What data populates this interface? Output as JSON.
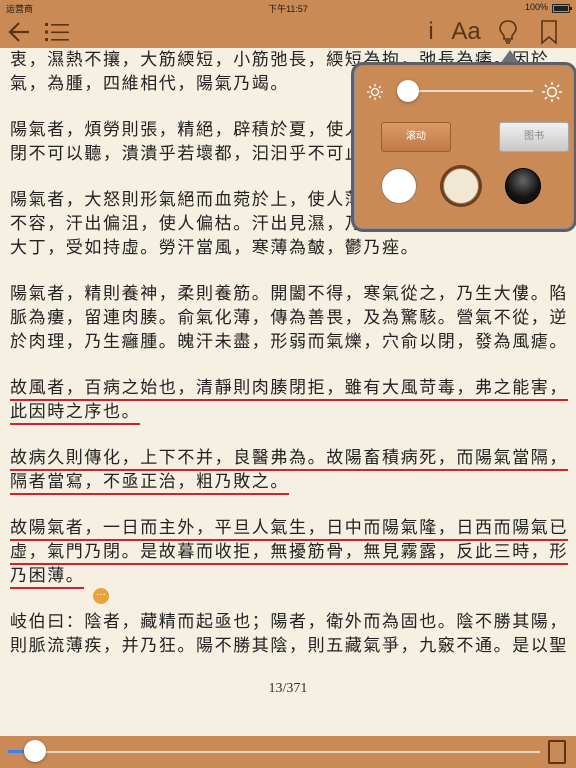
{
  "status_bar": {
    "carrier": "运营商",
    "time": "下午11:57",
    "battery": "100%"
  },
  "toolbar": {
    "back_icon": "arrow-left",
    "toc_icon": "list",
    "info_label": "i",
    "font_label": "Aa",
    "brightness_icon": "lightbulb",
    "bookmark_icon": "bookmark"
  },
  "content": {
    "paragraphs": [
      {
        "lines": [
          [
            {
              "t": "衷，濕熱不攘，大筋緛短，小筋弛長，緛短為拘，弛長為痿。因於"
            }
          ],
          [
            {
              "t": "氣，為腫，四維相代，陽氣乃竭。"
            }
          ]
        ]
      },
      {
        "lines": [
          [
            {
              "t": "陽氣者，煩勞則張，精絕，辟積於夏，使人煎厥。目盲不可以視，耳"
            }
          ],
          [
            {
              "t": "閉不可以聽，潰潰乎若壞都，汩汩乎不可止。"
            }
          ]
        ]
      },
      {
        "lines": [
          [
            {
              "t": "陽氣者，大怒則形氣絕而血菀於上，使人薄厥。有傷於筋，縱，其若"
            }
          ],
          [
            {
              "t": "不容，汗出偏沮，使人偏枯。汗出見濕，乃生痤疿。高梁之變，足生"
            }
          ],
          [
            {
              "t": "大丁，受如持虛。勞汗當風，寒薄為皶，鬱乃痤。"
            }
          ]
        ]
      },
      {
        "lines": [
          [
            {
              "t": "陽氣者，精則養神，柔則養筋。開闔不得，寒氣從之，乃生大僂。陷"
            }
          ],
          [
            {
              "t": "脈為瘻，留連肉腠。俞氣化薄，傳為善畏，及為驚駭。營氣不從，逆"
            }
          ],
          [
            {
              "t": "於肉理，乃生癰腫。魄汗未盡，形弱而氣爍，穴俞以閉，發為風瘧。"
            }
          ]
        ]
      },
      {
        "lines": [
          [
            {
              "t": "故風者，百病之始也，清靜則肉腠閉拒，雖有大風苛毒，弗之能害，",
              "hl": true
            }
          ],
          [
            {
              "t": "此因時之序也。",
              "hl": true
            }
          ]
        ]
      },
      {
        "lines": [
          [
            {
              "t": "故病久則傳化，上下不并，良醫弗為。故陽畜積病死，而陽氣當隔，",
              "hl": true
            }
          ],
          [
            {
              "t": "隔者當寫，不亟正治，粗乃敗之。",
              "hl": true
            }
          ]
        ]
      },
      {
        "lines": [
          [
            {
              "t": "故陽氣者，一日而主外，平旦人氣生，日中而陽氣隆，日西而陽氣已",
              "hl": true
            }
          ],
          [
            {
              "t": "虛，氣門乃閉。是故暮而收拒，無擾筋骨，無見霧露，反此三時，形",
              "hl": true
            }
          ],
          [
            {
              "t": "乃困薄。",
              "hl": true
            }
          ]
        ]
      },
      {
        "lines": [
          [
            {
              "t": "岐伯曰：陰者，藏精而起亟也；陽者，衛外而為固也。陰不勝其陽，"
            }
          ],
          [
            {
              "t": "則脈流薄疾，并乃狂。陽不勝其陰，則五藏氣爭，九竅不通。是以聖"
            }
          ]
        ]
      }
    ],
    "note_icon": "ellipsis-bubble",
    "note_glyph": "···"
  },
  "page_indicator": "13/371",
  "bottom_bar": {
    "progress": 0.05,
    "page_icon": "page-turn"
  },
  "settings_popover": {
    "brightness": 0.07,
    "brightness_low_icon": "sun-small",
    "brightness_high_icon": "sun-large",
    "scroll_label": "滚动",
    "book_label": "图书",
    "themes": [
      {
        "name": "white-theme",
        "color": "#ffffff",
        "selected": false
      },
      {
        "name": "sepia-theme",
        "color": "#f1e8d4",
        "selected": true
      },
      {
        "name": "night-theme",
        "color": "#111111",
        "selected": false
      }
    ]
  },
  "colors": {
    "bar": "#c98a55",
    "page": "#f6f0e2",
    "text": "#222222",
    "highlight": "#d8202a",
    "accent": "#3a82f0"
  }
}
